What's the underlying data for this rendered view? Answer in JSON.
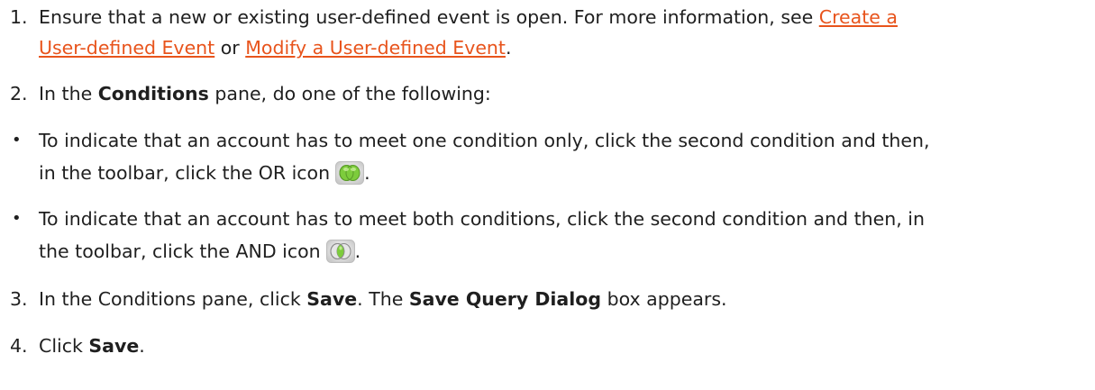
{
  "steps": {
    "s1": {
      "number": "1.",
      "line1_prefix": "Ensure that a new or existing user-defined event is open. For more information, see ",
      "link1_part1": "Create a",
      "link1_part2": "User-defined Event",
      "mid": " or ",
      "link2": "Modify a User-defined Event",
      "end": "."
    },
    "s2": {
      "number": "2.",
      "prefix": "In the ",
      "bold": "Conditions",
      "suffix": " pane, do one of the following:"
    },
    "b1": {
      "line1": "To indicate that an account has to meet one condition only, click the second condition and then,",
      "line2": "in the toolbar, click the OR icon",
      "end": ".",
      "icon": "or-condition-icon"
    },
    "b2": {
      "line1": "To indicate that an account has to meet both conditions, click the second condition and then, in",
      "line2": "the toolbar, click the AND icon",
      "end": ".",
      "icon": "and-condition-icon"
    },
    "s3": {
      "number": "3.",
      "prefix": "In the Conditions pane, click ",
      "bold1": "Save",
      "mid": ". The ",
      "bold2": "Save Query Dialog",
      "suffix": " box appears."
    },
    "s4": {
      "number": "4.",
      "prefix": "Click ",
      "bold": "Save",
      "suffix": "."
    }
  },
  "colors": {
    "link": "#e8541c",
    "text": "#1f1f1f",
    "icon_green": "#7dcc3c"
  }
}
